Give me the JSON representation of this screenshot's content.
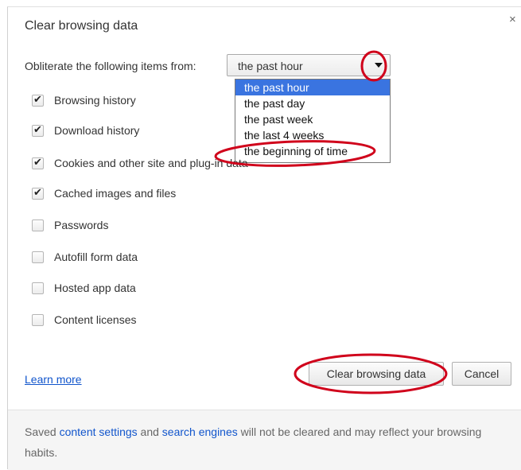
{
  "dialog": {
    "title": "Clear browsing data",
    "close_glyph": "×"
  },
  "time_range": {
    "label": "Obliterate the following items from:",
    "selected": "the past hour",
    "options": [
      "the past hour",
      "the past day",
      "the past week",
      "the last 4 weeks",
      "the beginning of time"
    ],
    "highlighted_index": 0
  },
  "items": [
    {
      "label": "Browsing history",
      "checked": true
    },
    {
      "label": "Download history",
      "checked": true
    },
    {
      "label": "Cookies and other site and plug-in data",
      "checked": true
    },
    {
      "label": "Cached images and files",
      "checked": true
    },
    {
      "label": "Passwords",
      "checked": false
    },
    {
      "label": "Autofill form data",
      "checked": false
    },
    {
      "label": "Hosted app data",
      "checked": false
    },
    {
      "label": "Content licenses",
      "checked": false
    }
  ],
  "actions": {
    "learn_more": "Learn more",
    "clear": "Clear browsing data",
    "cancel": "Cancel"
  },
  "footer": {
    "part1": "Saved ",
    "link1": "content settings",
    "part2": " and ",
    "link2": "search engines",
    "part3": " will not be cleared and may reflect your browsing habits."
  },
  "icons": {
    "check": "✔",
    "dropdown_arrow": "chevron-down-icon",
    "close": "close-icon"
  },
  "colors": {
    "accent": "#3a74e0",
    "link": "#1155cc",
    "annotation": "#d0021b"
  }
}
